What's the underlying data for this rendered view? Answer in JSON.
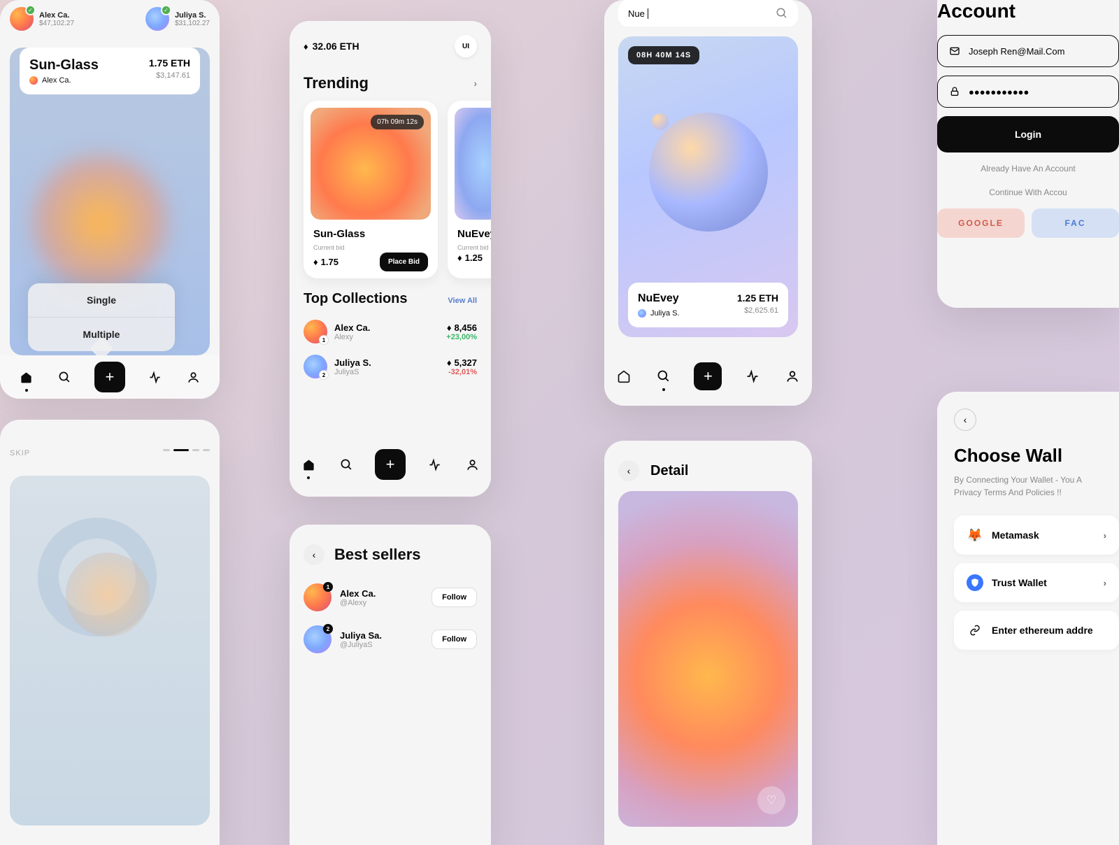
{
  "screen1": {
    "users": [
      {
        "name": "Alex Ca.",
        "amount": "$47,102.27"
      },
      {
        "name": "Juliya S.",
        "amount": "$31,102.27"
      }
    ],
    "nft": {
      "title": "Sun-Glass",
      "creator": "Alex Ca.",
      "price": "1.75 ETH",
      "usd": "$3,147.61"
    },
    "popup": {
      "single": "Single",
      "multiple": "Multiple"
    }
  },
  "screen2": {
    "skip": "SKIP"
  },
  "screen3": {
    "balance": "32.06 ETH",
    "ui": "UI",
    "trending": "Trending",
    "cards": [
      {
        "title": "Sun-Glass",
        "timer": "07h 09m 12s",
        "label": "Current bid",
        "bid": "1.75",
        "btn": "Place Bid"
      },
      {
        "title": "NuEvey",
        "label": "Current bid",
        "bid": "1.25"
      }
    ],
    "topcol": {
      "title": "Top Collections",
      "viewall": "View All"
    },
    "collections": [
      {
        "rank": "1",
        "name": "Alex Ca.",
        "handle": "Alexy",
        "val": "8,456",
        "pct": "+23,00%"
      },
      {
        "rank": "2",
        "name": "Juliya S.",
        "handle": "JuliyaS",
        "val": "5,327",
        "pct": "-32,01%"
      }
    ]
  },
  "screen4": {
    "title": "Best sellers",
    "sellers": [
      {
        "rank": "1",
        "name": "Alex Ca.",
        "handle": "@Alexy",
        "btn": "Follow"
      },
      {
        "rank": "2",
        "name": "Juliya Sa.",
        "handle": "@JuliyaS",
        "btn": "Follow"
      }
    ]
  },
  "screen5": {
    "search": "Nue",
    "timer": "08H  40M  14S",
    "nft": {
      "title": "NuEvey",
      "creator": "Juliya S.",
      "price": "1.25 ETH",
      "usd": "$2,625.61"
    }
  },
  "screen6": {
    "title": "Detail"
  },
  "screen7": {
    "title": "Account",
    "email": "Joseph Ren@Mail.Com",
    "password": "●●●●●●●●●●●",
    "login": "Login",
    "already": "Already Have An Account",
    "continue": "Continue With Accou",
    "google": "GOOGLE",
    "facebook": "FAC"
  },
  "screen8": {
    "title": "Choose Wall",
    "desc1": "By Connecting Your Wallet - You A",
    "desc2": "Privacy Terms And Policies !!",
    "wallets": [
      {
        "name": "Metamask"
      },
      {
        "name": "Trust Wallet"
      },
      {
        "name": "Enter ethereum addre"
      }
    ]
  }
}
